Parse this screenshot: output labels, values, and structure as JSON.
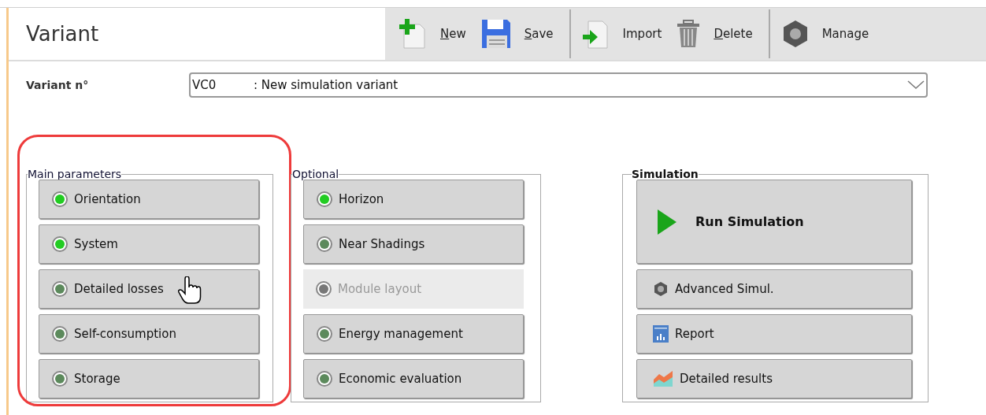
{
  "header": {
    "title": "Variant"
  },
  "toolbar": [
    {
      "kind": "new",
      "label": "New",
      "underlined_initial": true,
      "separator_after": false
    },
    {
      "kind": "save",
      "label": "Save",
      "underlined_initial": true,
      "separator_after": true
    },
    {
      "kind": "import",
      "label": "Import",
      "underlined_initial": false,
      "separator_after": false
    },
    {
      "kind": "delete",
      "label": "Delete",
      "underlined_initial": true,
      "separator_after": true
    },
    {
      "kind": "manage",
      "label": "Manage",
      "underlined_initial": false,
      "separator_after": false
    }
  ],
  "variant": {
    "label": "Variant n°",
    "code": "VC0",
    "description": ": New simulation variant"
  },
  "groups": [
    {
      "title": "Main parameters",
      "highlighted": true,
      "items": [
        {
          "label": "Orientation",
          "completed": true,
          "disabled": false,
          "hovered": false
        },
        {
          "label": "System",
          "completed": true,
          "disabled": false,
          "hovered": false
        },
        {
          "label": "Detailed losses",
          "completed": false,
          "disabled": false,
          "hovered": true
        },
        {
          "label": "Self-consumption",
          "completed": false,
          "disabled": false,
          "hovered": false
        },
        {
          "label": "Storage",
          "completed": false,
          "disabled": false,
          "hovered": false
        }
      ]
    },
    {
      "title": "Optional",
      "highlighted": false,
      "items": [
        {
          "label": "Horizon",
          "completed": true,
          "disabled": false,
          "hovered": false
        },
        {
          "label": "Near Shadings",
          "completed": false,
          "disabled": false,
          "hovered": false
        },
        {
          "label": "Module layout",
          "disabled": true,
          "hovered": false
        },
        {
          "label": "Energy management",
          "completed": false,
          "disabled": false,
          "hovered": false
        },
        {
          "label": "Economic evaluation",
          "completed": false,
          "disabled": false,
          "hovered": false
        }
      ]
    }
  ],
  "simulation": {
    "title": "Simulation",
    "buttons": [
      {
        "kind": "run",
        "label": "Run Simulation"
      },
      {
        "kind": "advanced",
        "label": "Advanced Simul."
      },
      {
        "kind": "report",
        "label": "Report"
      },
      {
        "kind": "results",
        "label": "Detailed results"
      }
    ]
  }
}
